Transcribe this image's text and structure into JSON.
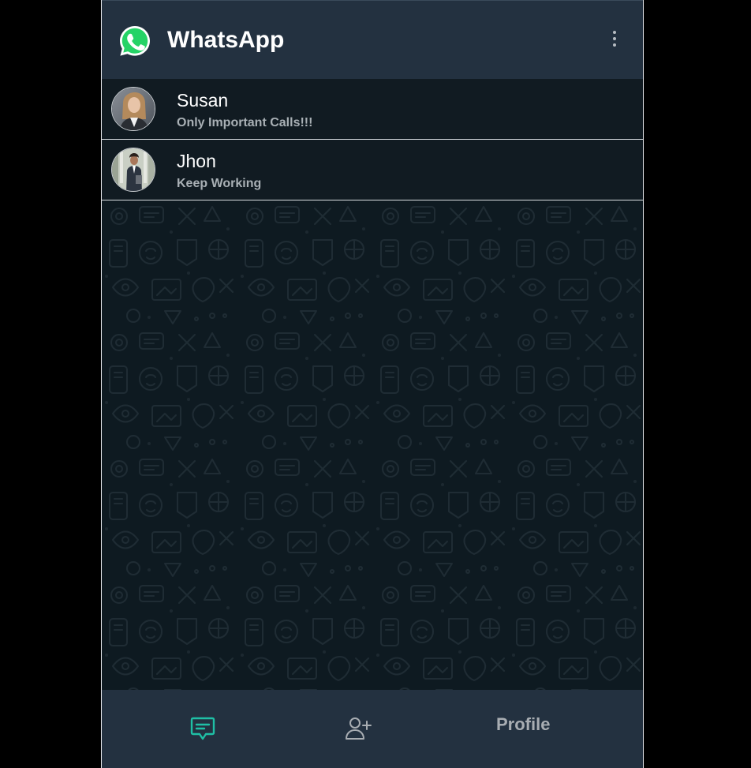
{
  "header": {
    "title": "WhatsApp",
    "logo_icon": "whatsapp-logo-icon",
    "menu_icon": "more-vertical-icon"
  },
  "chats": [
    {
      "name": "Susan",
      "status": "Only Important Calls!!!",
      "avatar": "avatar-photo-woman"
    },
    {
      "name": "Jhon",
      "status": "Keep Working",
      "avatar": "avatar-photo-man"
    }
  ],
  "bottom_nav": {
    "chats_icon": "message-square-icon",
    "add_contact_icon": "user-plus-icon",
    "profile_label": "Profile"
  },
  "colors": {
    "accent": "#25d366",
    "active_nav": "#1fbfa5",
    "header_bg": "#233140",
    "chat_bg": "#111b22",
    "wallpaper_bg": "#0e1a21"
  }
}
